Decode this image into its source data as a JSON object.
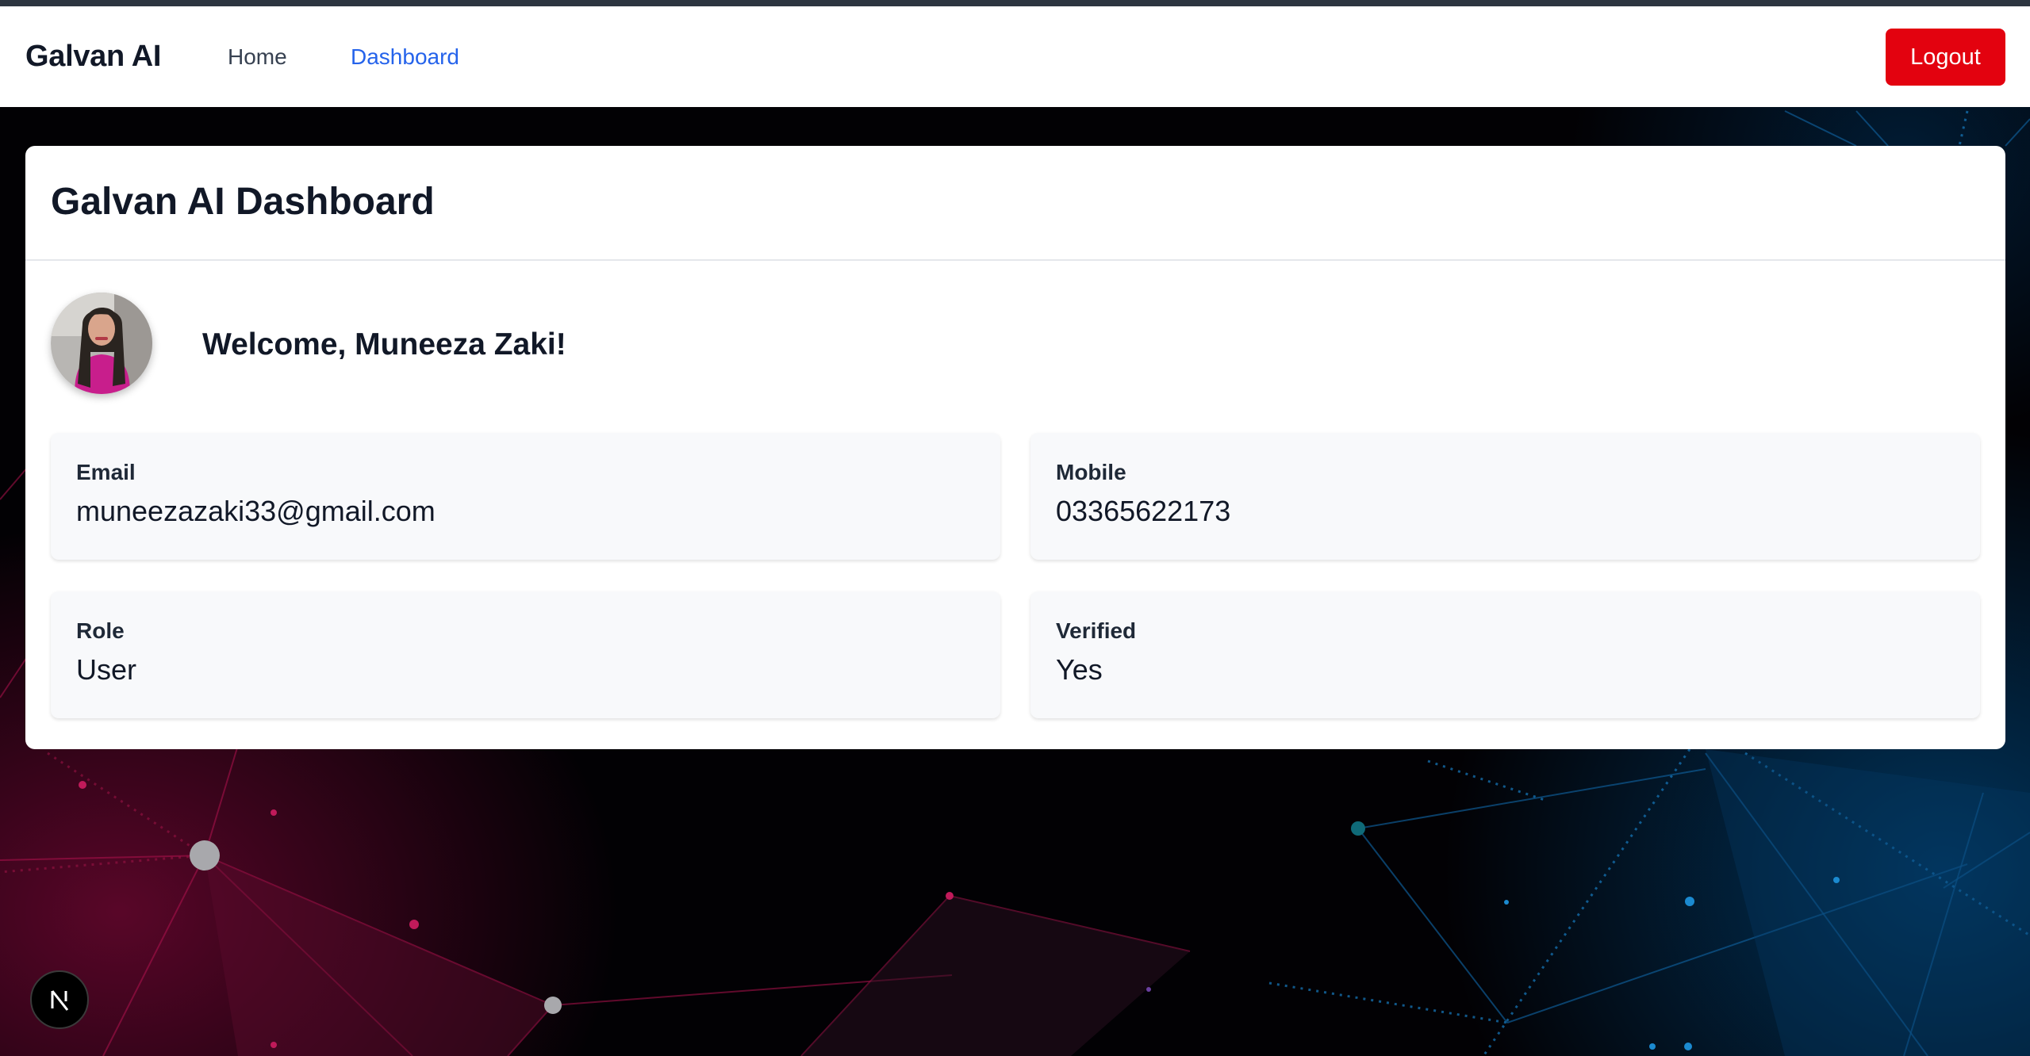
{
  "navbar": {
    "brand": "Galvan AI",
    "links": [
      {
        "label": "Home"
      },
      {
        "label": "Dashboard",
        "active": true
      }
    ],
    "logout_label": "Logout"
  },
  "dashboard": {
    "title": "Galvan AI Dashboard",
    "welcome": "Welcome, Muneeza Zaki!",
    "fields": {
      "email": {
        "label": "Email",
        "value": "muneezazaki33@gmail.com"
      },
      "mobile": {
        "label": "Mobile",
        "value": "03365622173"
      },
      "role": {
        "label": "Role",
        "value": "User"
      },
      "verified": {
        "label": "Verified",
        "value": "Yes"
      }
    }
  },
  "colors": {
    "accent_link": "#2563eb",
    "logout_bg": "#e3020f",
    "card_bg": "#ffffff",
    "field_bg": "#f8f9fb"
  },
  "icons": {
    "avatar": "profile-photo",
    "dev_badge": "nextjs-logo"
  }
}
